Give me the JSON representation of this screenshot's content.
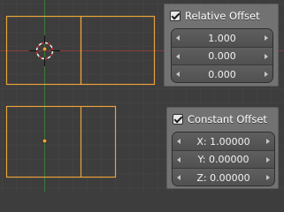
{
  "relative_offset": {
    "label": "Relative Offset",
    "checked": true,
    "values": [
      "1.000",
      "0.000",
      "0.000"
    ]
  },
  "constant_offset": {
    "label": "Constant Offset",
    "checked": true,
    "values": [
      "X: 1.00000",
      "Y: 0.00000",
      "Z: 0.00000"
    ]
  },
  "colors": {
    "viewport_bg": "#3d3d3d",
    "grid": "#474747",
    "x_axis": "#8a3b3b",
    "y_axis": "#3c7a3c",
    "selection": "#e8a23c",
    "panel_bg": "#727272",
    "field_bg": "#555555"
  }
}
